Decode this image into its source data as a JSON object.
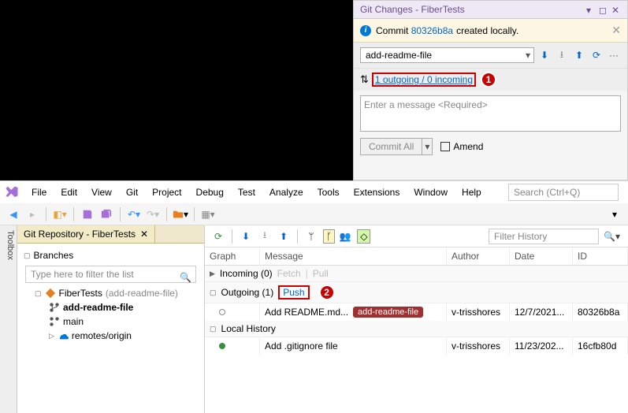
{
  "git_changes": {
    "title": "Git Changes - FiberTests",
    "info_prefix": "Commit",
    "info_commit": "80326b8a",
    "info_suffix": "created locally.",
    "branch": "add-readme-file",
    "outgoing_link": "1 outgoing / 0 incoming",
    "callout1": "1",
    "message_placeholder": "Enter a message <Required>",
    "commit_all": "Commit All",
    "amend": "Amend"
  },
  "menu": {
    "items": [
      "File",
      "Edit",
      "View",
      "Git",
      "Project",
      "Debug",
      "Test",
      "Analyze",
      "Tools",
      "Extensions",
      "Window",
      "Help"
    ],
    "search_placeholder": "Search (Ctrl+Q)"
  },
  "repo_tab": "Git Repository - FiberTests",
  "tree": {
    "branches": "Branches",
    "filter_placeholder": "Type here to filter the list",
    "repo": "FiberTests",
    "repo_branch": "(add-readme-file)",
    "b1": "add-readme-file",
    "b2": "main",
    "remotes": "remotes/origin"
  },
  "hist": {
    "filter_placeholder": "Filter History",
    "cols": {
      "graph": "Graph",
      "msg": "Message",
      "auth": "Author",
      "date": "Date",
      "id": "ID"
    },
    "incoming": "Incoming (0)",
    "fetch": "Fetch",
    "pull": "Pull",
    "outgoing": "Outgoing (1)",
    "push": "Push",
    "callout2": "2",
    "r1": {
      "msg": "Add README.md...",
      "tag": "add-readme-file",
      "auth": "v-trisshores",
      "date": "12/7/2021...",
      "id": "80326b8a"
    },
    "local": "Local History",
    "r2": {
      "msg": "Add .gitignore file",
      "auth": "v-trisshores",
      "date": "11/23/202...",
      "id": "16cfb80d"
    },
    "toolbox": "Toolbox"
  }
}
